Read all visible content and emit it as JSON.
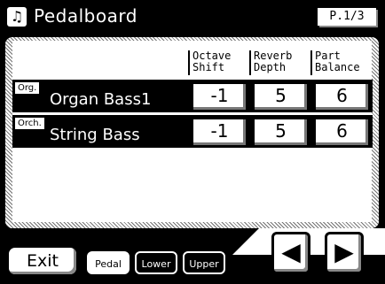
{
  "header": {
    "title": "Pedalboard",
    "icon": "music-note-icon",
    "page_indicator": "P.1/3"
  },
  "columns": [
    {
      "label": "Octave\nShift"
    },
    {
      "label": "Reverb\nDepth"
    },
    {
      "label": "Part\nBalance"
    }
  ],
  "rows": [
    {
      "tag": "Org.",
      "name": "Organ Bass1",
      "values": [
        "-1",
        "5",
        "6"
      ]
    },
    {
      "tag": "Orch.",
      "name": "String Bass",
      "values": [
        "-1",
        "5",
        "6"
      ]
    }
  ],
  "footer": {
    "exit_label": "Exit",
    "tabs": [
      {
        "label": "Pedal",
        "selected": true
      },
      {
        "label": "Lower",
        "selected": false
      },
      {
        "label": "Upper",
        "selected": false
      }
    ],
    "prev_icon": "prev-page-icon",
    "next_icon": "next-page-icon"
  }
}
